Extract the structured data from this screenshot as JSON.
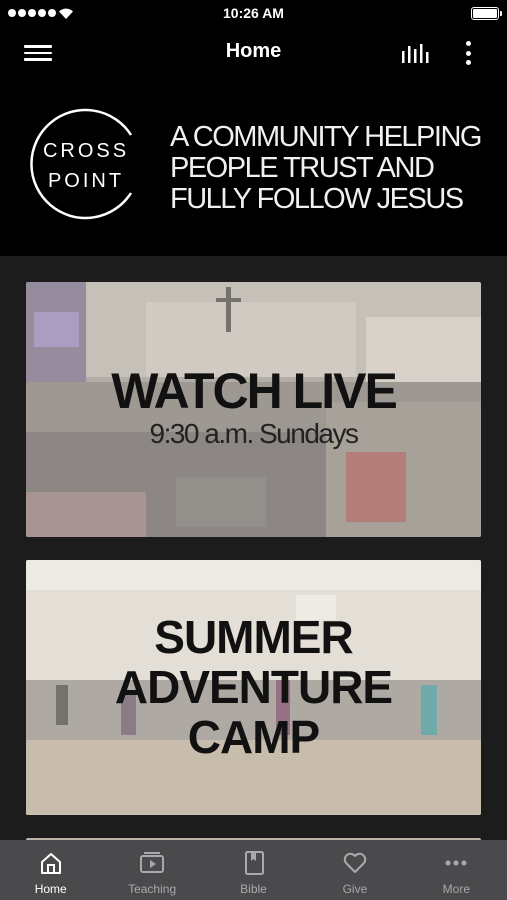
{
  "status_bar": {
    "time": "10:26 AM"
  },
  "nav": {
    "title": "Home"
  },
  "banner": {
    "logo_line1": "CROSS",
    "logo_line2": "POINT",
    "tagline": [
      "A COMMUNITY HELPING",
      "PEOPLE TRUST AND",
      "FULLY FOLLOW JESUS"
    ]
  },
  "cards": [
    {
      "title": "WATCH LIVE",
      "subtitle": "9:30 a.m. Sundays"
    },
    {
      "title_lines": [
        "SUMMER",
        "ADVENTURE",
        "CAMP"
      ]
    }
  ],
  "tabs": [
    {
      "label": "Home",
      "icon": "home-icon",
      "active": true
    },
    {
      "label": "Teaching",
      "icon": "video-icon",
      "active": false
    },
    {
      "label": "Bible",
      "icon": "bible-icon",
      "active": false
    },
    {
      "label": "Give",
      "icon": "heart-icon",
      "active": false
    },
    {
      "label": "More",
      "icon": "more-dots-icon",
      "active": false
    }
  ],
  "colors": {
    "background": "#1c1c1d",
    "bars": "#000000",
    "tab_bar": "#4a4a4c"
  }
}
